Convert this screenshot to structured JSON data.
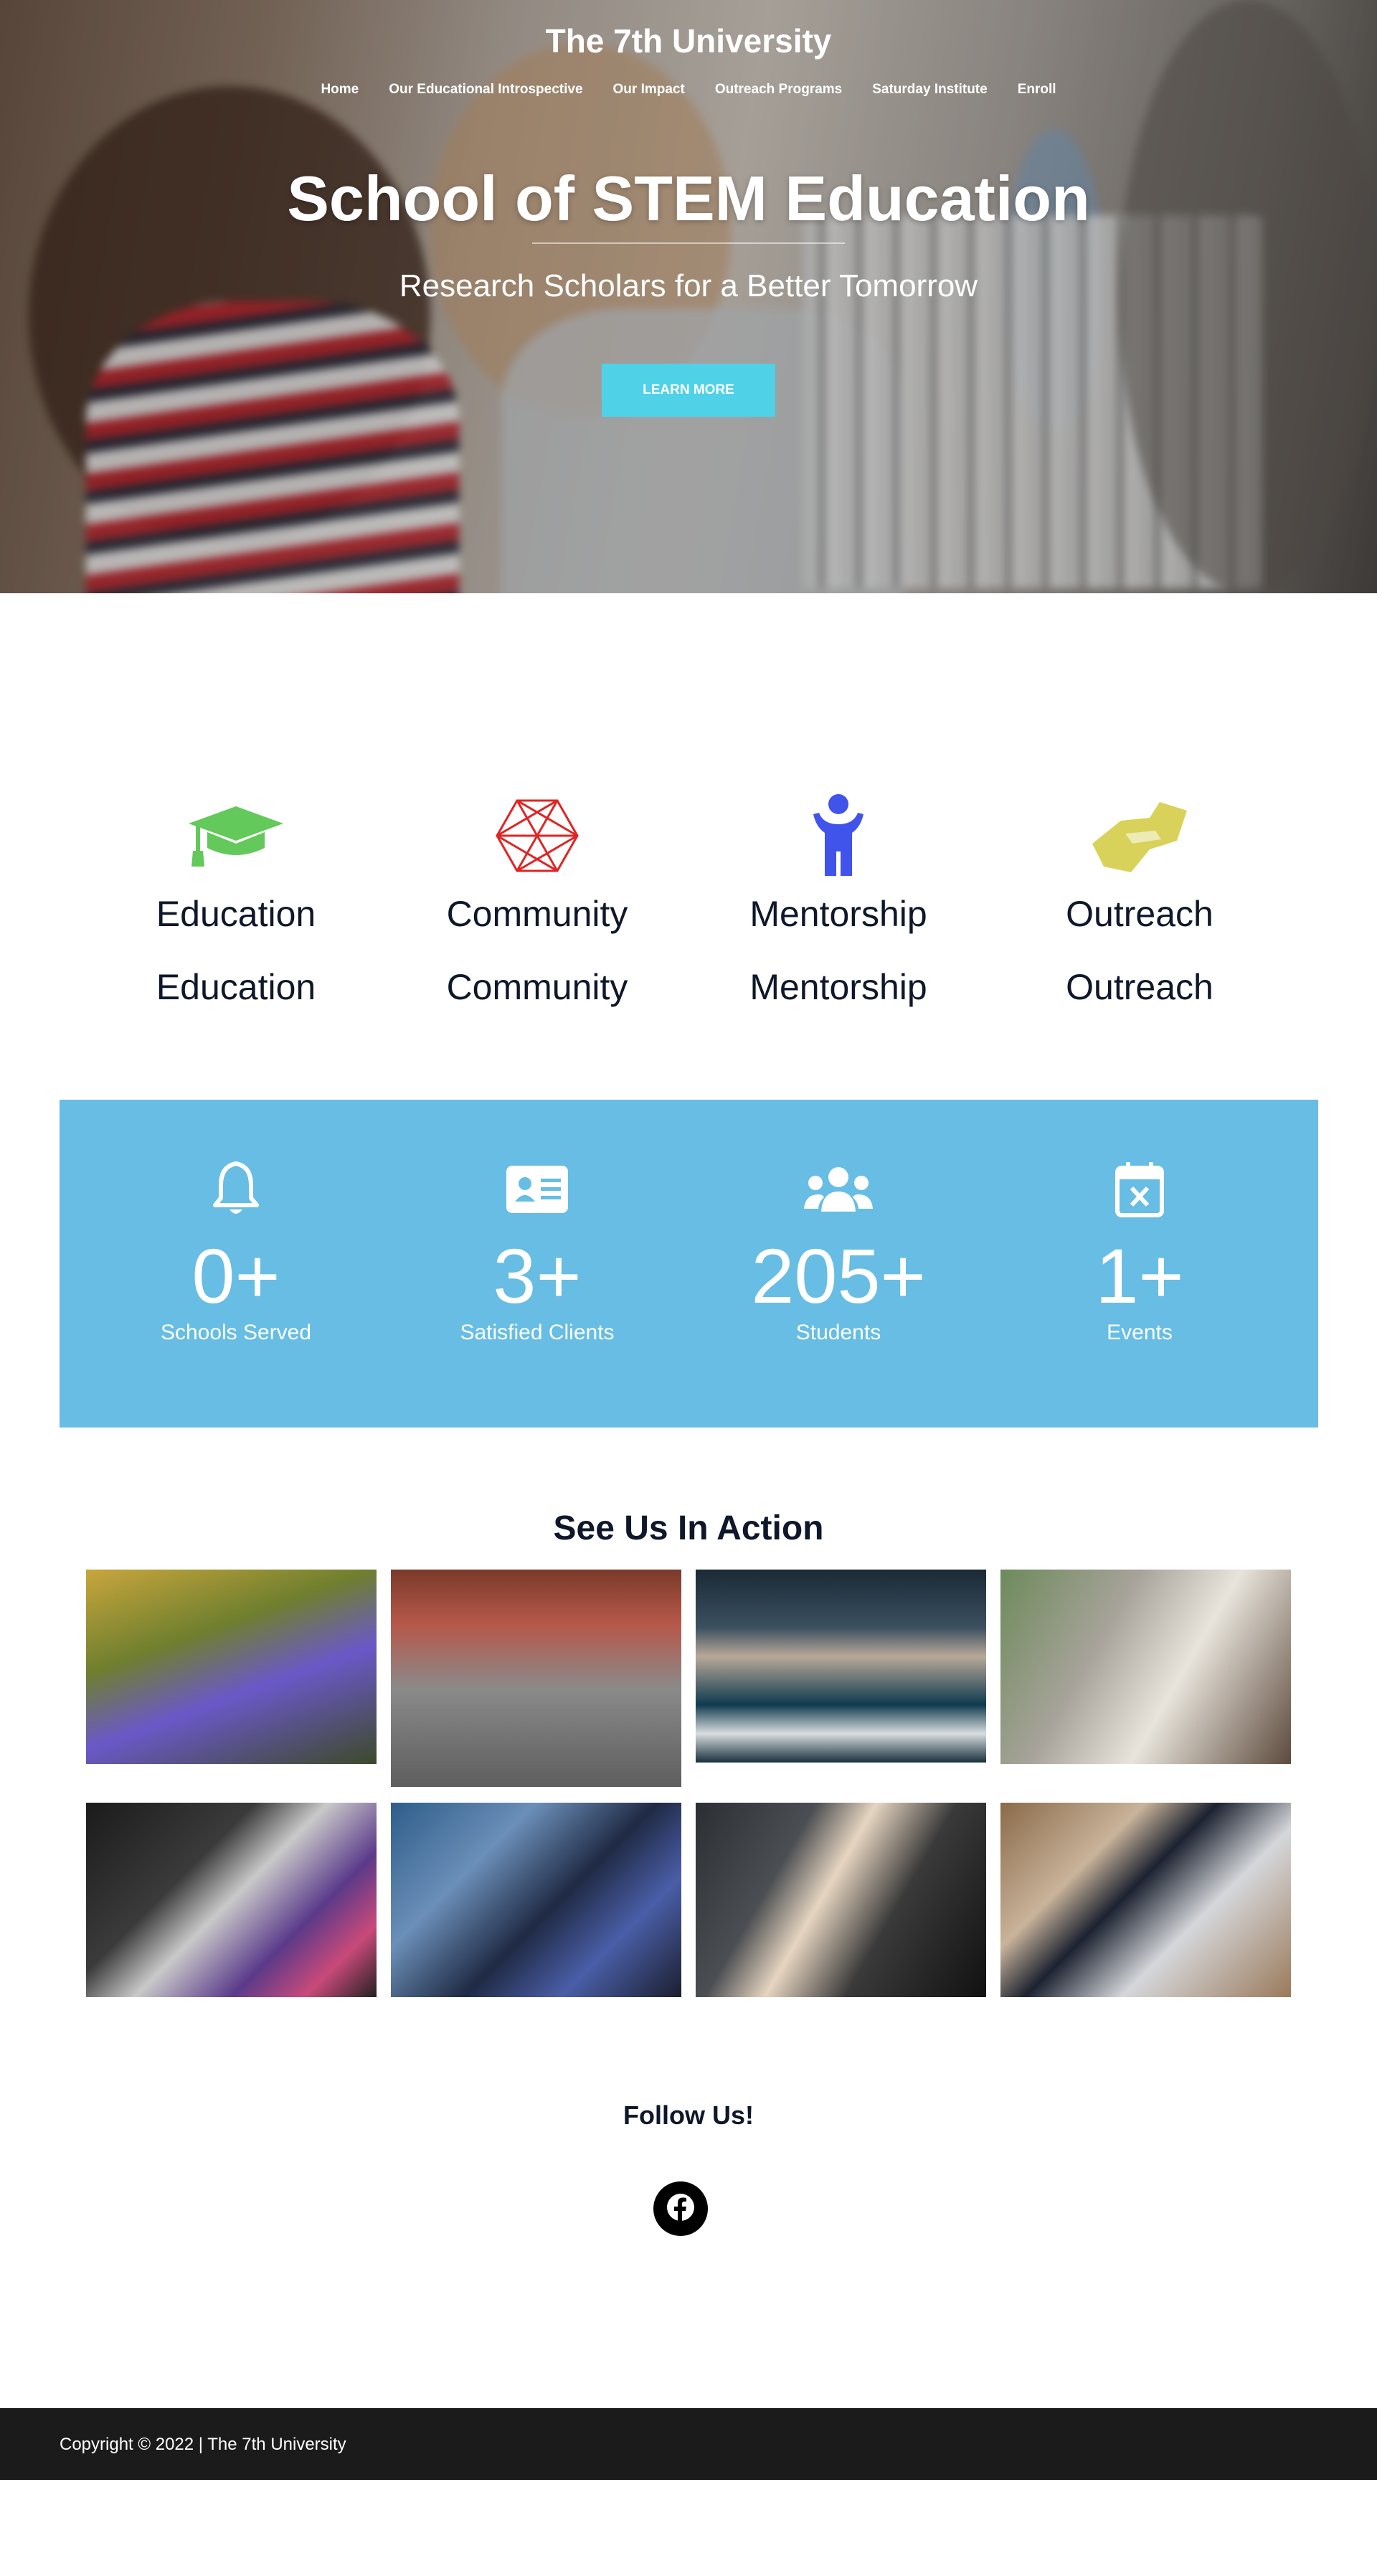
{
  "header": {
    "brand": "The 7th University",
    "nav": [
      "Home",
      "Our Educational Introspective",
      "Our Impact",
      "Outreach Programs",
      "Saturday Institute",
      "Enroll"
    ]
  },
  "hero": {
    "title": "School of STEM Education",
    "subtitle": "Research Scholars for a Better Tomorrow",
    "cta_label": "LEARN MORE"
  },
  "features": [
    {
      "icon": "graduation-cap-icon",
      "color": "#62c95a",
      "title": "Education",
      "subtitle": "Education"
    },
    {
      "icon": "network-icon",
      "color": "#e02424",
      "title": "Community",
      "subtitle": "Community"
    },
    {
      "icon": "person-icon",
      "color": "#4053ea",
      "title": "Mentorship",
      "subtitle": "Mentorship"
    },
    {
      "icon": "handshake-icon",
      "color": "#d8d25a",
      "title": "Outreach",
      "subtitle": "Outreach"
    }
  ],
  "stats": {
    "background": "#67bde3",
    "items": [
      {
        "icon": "bell-icon",
        "value": "0",
        "suffix": "+",
        "label": "Schools Served"
      },
      {
        "icon": "id-card-icon",
        "value": "3",
        "suffix": "+",
        "label": "Satisfied Clients"
      },
      {
        "icon": "users-icon",
        "value": "205",
        "suffix": "+",
        "label": "Students"
      },
      {
        "icon": "calendar-x-icon",
        "value": "1",
        "suffix": "+",
        "label": "Events"
      }
    ]
  },
  "gallery": {
    "title": "See Us In Action"
  },
  "follow": {
    "title": "Follow Us!",
    "icon": "facebook-icon"
  },
  "footer": {
    "copyright": "Copyright © 2022 | The 7th University"
  },
  "colors": {
    "accent": "#4fd1e8",
    "text_dark": "#0f172a",
    "footer_bg": "#1b1b1b"
  }
}
